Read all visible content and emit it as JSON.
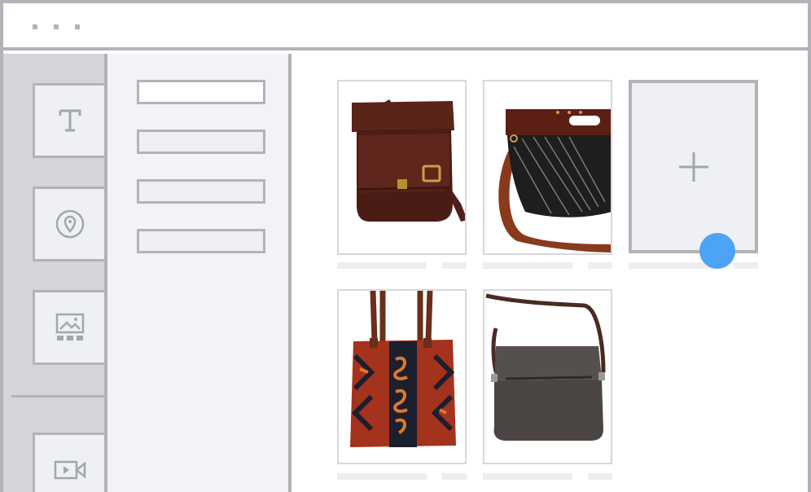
{
  "window": {
    "titlebar_dots": [
      "dot",
      "dot",
      "dot"
    ]
  },
  "toolbar": {
    "tools": [
      {
        "name": "text-tool",
        "icon": "text-icon"
      },
      {
        "name": "location-tool",
        "icon": "map-pin-icon"
      },
      {
        "name": "gallery-tool",
        "icon": "image-gallery-icon"
      },
      {
        "name": "video-tool",
        "icon": "video-camera-icon"
      }
    ]
  },
  "panel": {
    "fields": [
      {
        "name": "field-1",
        "value": ""
      },
      {
        "name": "field-2",
        "value": ""
      },
      {
        "name": "field-3",
        "value": ""
      },
      {
        "name": "field-4",
        "value": ""
      }
    ]
  },
  "gallery": {
    "items": [
      {
        "name": "brown-leather-messenger-bag",
        "icon": "product-photo"
      },
      {
        "name": "black-leather-tote-bag",
        "icon": "product-photo"
      },
      {
        "name": "kilim-pattern-tote-bag",
        "icon": "product-photo"
      },
      {
        "name": "grey-crossbody-bag",
        "icon": "product-photo"
      }
    ],
    "add_tile": {
      "icon": "plus-icon"
    }
  },
  "colors": {
    "frame_border": "#b1b3b7",
    "rail_bg": "#d3d5d8",
    "panel_bg": "#f1f3f6",
    "cursor": "#4da3f5"
  }
}
